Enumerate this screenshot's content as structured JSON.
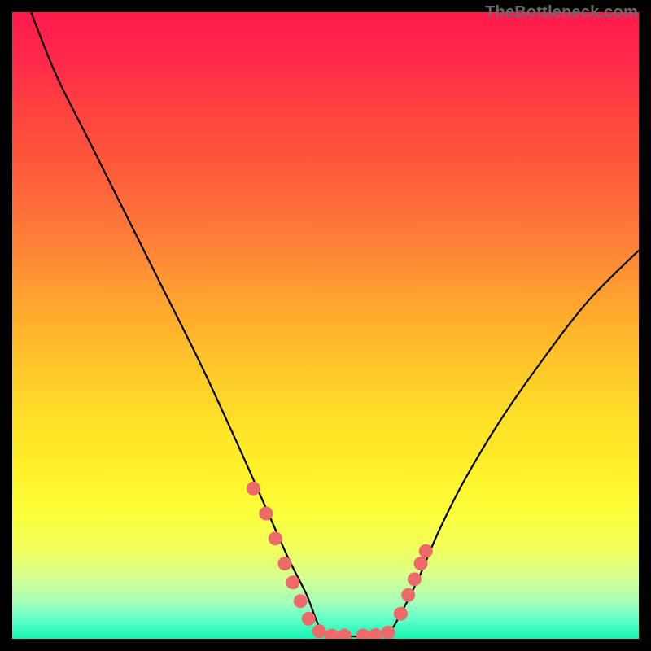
{
  "watermark": "TheBottleneck.com",
  "chart_data": {
    "type": "line",
    "title": "",
    "xlabel": "",
    "ylabel": "",
    "xlim": [
      0,
      100
    ],
    "ylim": [
      0,
      100
    ],
    "series": [
      {
        "name": "curve",
        "x": [
          3,
          7,
          12,
          18,
          24,
          30,
          36,
          40,
          44,
          47,
          49,
          51,
          54,
          57,
          60,
          62,
          65,
          68,
          72,
          78,
          85,
          92,
          100
        ],
        "y": [
          100,
          90,
          80,
          68,
          56,
          44,
          31,
          22,
          13,
          7,
          2,
          0.5,
          0.4,
          0.4,
          1,
          4,
          10,
          17,
          25,
          35,
          45,
          54,
          62
        ]
      }
    ],
    "markers": [
      {
        "x": 38.5,
        "y": 24
      },
      {
        "x": 40.5,
        "y": 20
      },
      {
        "x": 42.0,
        "y": 16
      },
      {
        "x": 43.5,
        "y": 12
      },
      {
        "x": 44.8,
        "y": 9
      },
      {
        "x": 46.0,
        "y": 6
      },
      {
        "x": 47.3,
        "y": 3.2
      },
      {
        "x": 49.0,
        "y": 1.2
      },
      {
        "x": 51.0,
        "y": 0.5
      },
      {
        "x": 53.0,
        "y": 0.5
      },
      {
        "x": 56.0,
        "y": 0.5
      },
      {
        "x": 58.0,
        "y": 0.6
      },
      {
        "x": 60.0,
        "y": 1.0
      },
      {
        "x": 62.0,
        "y": 4.0
      },
      {
        "x": 63.2,
        "y": 7.0
      },
      {
        "x": 64.2,
        "y": 9.5
      },
      {
        "x": 65.2,
        "y": 12.0
      },
      {
        "x": 66.0,
        "y": 14.0
      }
    ],
    "gradient_stops": [
      {
        "pos": 0.0,
        "color": "#ff1a4d"
      },
      {
        "pos": 0.5,
        "color": "#ffcc28"
      },
      {
        "pos": 0.9,
        "color": "#e0ff80"
      },
      {
        "pos": 1.0,
        "color": "#10f8b0"
      }
    ]
  }
}
